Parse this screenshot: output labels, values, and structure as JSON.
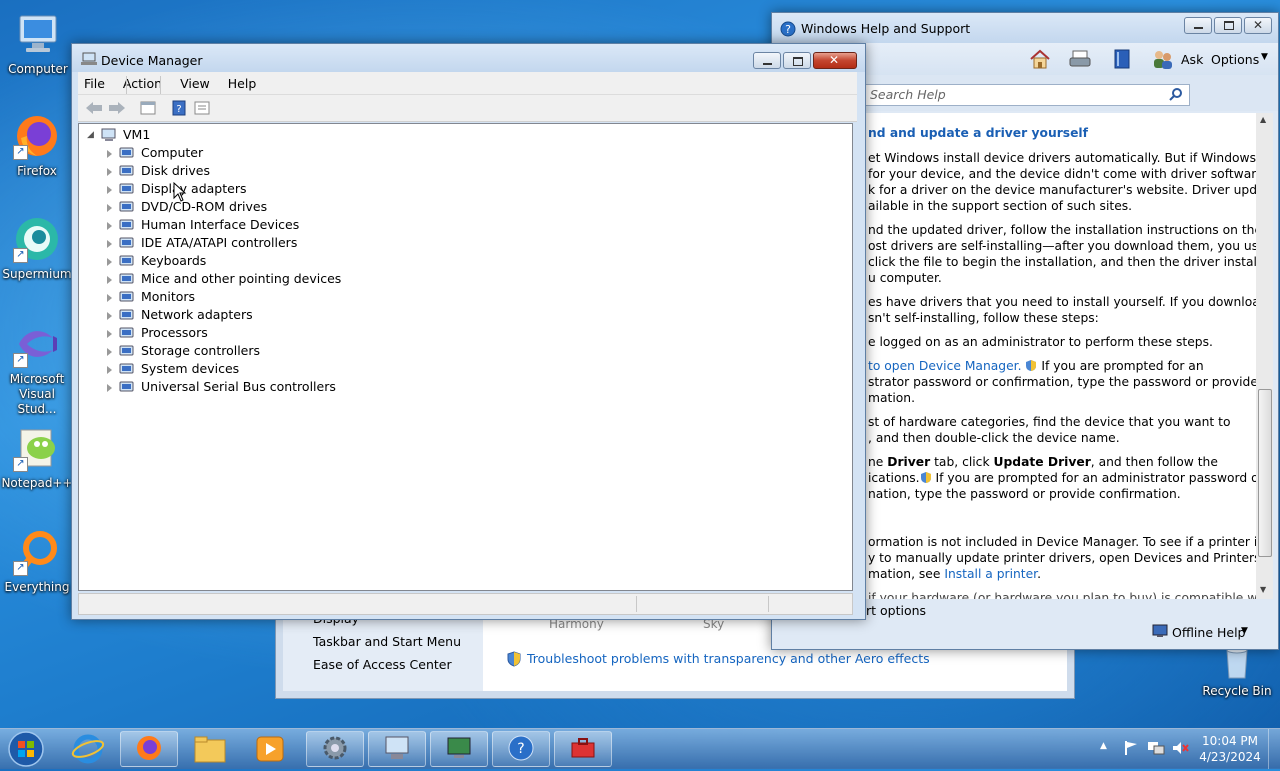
{
  "desktop": {
    "icons": [
      {
        "label": "Computer"
      },
      {
        "label": "Firefox"
      },
      {
        "label": "Supermium"
      },
      {
        "label": "Microsoft Visual Stud..."
      },
      {
        "label": "Notepad++"
      },
      {
        "label": "Everything"
      },
      {
        "label": "Recycle Bin"
      }
    ]
  },
  "device_manager": {
    "title": "Device Manager",
    "menu": [
      "File",
      "Action",
      "View",
      "Help"
    ],
    "root": "VM1",
    "categories": [
      {
        "label": "Computer",
        "icon": "computer-icon"
      },
      {
        "label": "Disk drives",
        "icon": "disk-drive-icon"
      },
      {
        "label": "Display adapters",
        "icon": "display-adapter-icon"
      },
      {
        "label": "DVD/CD-ROM drives",
        "icon": "dvd-drive-icon"
      },
      {
        "label": "Human Interface Devices",
        "icon": "hid-icon"
      },
      {
        "label": "IDE ATA/ATAPI controllers",
        "icon": "ide-controller-icon"
      },
      {
        "label": "Keyboards",
        "icon": "keyboard-icon"
      },
      {
        "label": "Mice and other pointing devices",
        "icon": "mouse-icon"
      },
      {
        "label": "Monitors",
        "icon": "monitor-icon"
      },
      {
        "label": "Network adapters",
        "icon": "network-adapter-icon"
      },
      {
        "label": "Processors",
        "icon": "processor-icon"
      },
      {
        "label": "Storage controllers",
        "icon": "storage-controller-icon"
      },
      {
        "label": "System devices",
        "icon": "system-devices-icon"
      },
      {
        "label": "Universal Serial Bus controllers",
        "icon": "usb-icon"
      }
    ]
  },
  "help": {
    "title": "Windows Help and Support",
    "toolbar": {
      "ask": "Ask",
      "options": "Options"
    },
    "search_placeholder": "Search Help",
    "heading": "nd and update a driver yourself",
    "lines": [
      "et Windows install device drivers automatically. But if Windows can't",
      " for your device, and the device didn't come with driver software,",
      "k for a driver on the device manufacturer's website. Driver updates",
      "ailable in the support section of such sites.",
      "nd the updated driver, follow the installation instructions on the",
      "ost drivers are self-installing—after you download them, you usually",
      " click the file to begin the installation, and then the driver installs",
      "u computer.",
      "es have drivers that you need to install yourself. If you download a",
      "sn't self-installing, follow these steps:",
      "e logged on as an administrator to perform these steps.",
      "strator password or confirmation, type the password or provide",
      "mation.",
      "st of hardware categories, find the device that you want to",
      ", and then double-click the device name.",
      "ications.",
      "nation, type the password or provide confirmation.",
      "ormation is not included in Device Manager. To see if a printer is",
      "y to manually update printer drivers, open Devices and Printers. For",
      "mation, see ",
      " if your hardware (or hardware you plan to buy) is compatible with"
    ],
    "link_open_dm": "to open Device Manager.",
    "prompt_text": " If you are prompted for an",
    "driver_line_pre": "ne ",
    "driver_tab": "Driver",
    "driver_mid": " tab, click ",
    "update_driver": "Update Driver",
    "driver_post": ", and then follow the",
    "admin_prompt": " If you are prompted for an administrator password or",
    "install_printer": "Install a printer",
    "footer_left": "rt options",
    "offline_help": "Offline Help"
  },
  "personalization": {
    "links": [
      "Taskbar and Start Menu",
      "Ease of Access Center"
    ],
    "partial_link": "Display",
    "themes": [
      "Harmony",
      "Sky"
    ],
    "troubleshoot": "Troubleshoot problems with transparency and other Aero effects"
  },
  "taskbar": {
    "time": "10:04 PM",
    "date": "4/23/2024"
  }
}
